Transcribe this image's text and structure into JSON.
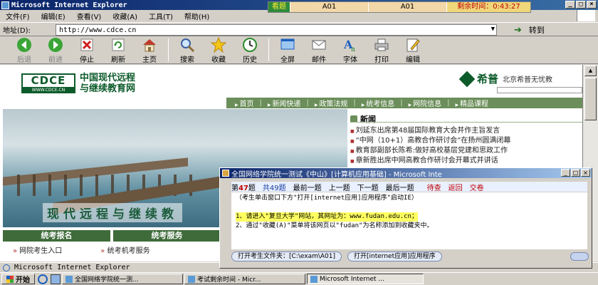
{
  "window": {
    "title": "Microsoft Internet Explorer"
  },
  "exam_strip": {
    "look_label": "看题",
    "field1": "A01",
    "field2": "A01",
    "timer_label": "剩余时间：0:43:27"
  },
  "menu": [
    "文件(F)",
    "编辑(E)",
    "查看(V)",
    "收藏(A)",
    "工具(T)",
    "帮助(H)"
  ],
  "address": {
    "label": "地址(D):",
    "url": "http://www.cdce.cn",
    "go_label": "转到"
  },
  "toolbar": {
    "back": "后退",
    "forward": "前进",
    "stop": "停止",
    "refresh": "刷新",
    "home": "主页",
    "search": "搜索",
    "favorites": "收藏",
    "history": "历史",
    "fullscreen": "全屏",
    "mail": "邮件",
    "font": "字体",
    "print": "打印",
    "edit": "编辑"
  },
  "page": {
    "logo_top": "CDCE",
    "logo_bottom": "WWW.CDCE.CN",
    "site_name_line1": "中国现代远程",
    "site_name_line2": "与继续教育网",
    "partner_name": "希普",
    "partner_desc": "北京希普无忧教",
    "nav": [
      "首页",
      "新闻快递",
      "政策法规",
      "统考信息",
      "网院信息",
      "精品课程"
    ],
    "hero_slogan": "现代远程与继续教",
    "news_title": "新闻",
    "news": [
      "刘延东出席第48届国际教育大会并作主旨发言",
      "“中网（10+1）高教合作研讨会”在扬州圆满闭幕",
      "教育部副部长陈希:做好高校基层党建和思政工作",
      "章新胜出席中网高教合作研讨会开幕式并讲话"
    ],
    "tabs": [
      "统考报名",
      "统考服务"
    ],
    "links": [
      "网院考生入口",
      "统考机考服务"
    ]
  },
  "dialog": {
    "title": "全国网络学院统一测试《中山》[计算机应用基础] - Microsoft Inte",
    "qno_prefix": "第",
    "qno_value": "47",
    "qno_suffix": "题",
    "total_prefix": "共",
    "total_value": "49",
    "total_suffix": "题",
    "first": "最前一题",
    "prev": "上一题",
    "next": "下一题",
    "last": "最后一题",
    "wait": "待查",
    "back": "返回",
    "submit": "交卷",
    "instruction": "（考生单击窗口下方\"打开[internet应用]应用程序\"启动IE）",
    "step1": "1、请进入\"复旦大学\"网站，其网址为：www.fudan.edu.cn；",
    "step2": "2、通过\"收藏(A)\"菜单将该网页以\"fudan\"为名称添加到收藏夹中。",
    "btn_open_folder": "打开考生文件夹：[C:\\exam\\A01]",
    "btn_open_app": "打开[internet应用]应用程序"
  },
  "statusbar": {
    "text": "Microsoft Internet Explorer"
  },
  "taskbar": {
    "start": "开始",
    "tasks": [
      "全国网络学院统一测...",
      "考试剩余时间 - Micr...",
      "Microsoft Internet ..."
    ]
  },
  "colors": {
    "titlebar": "#0a246a",
    "exam_green": "#2e8b3a",
    "timer_red": "#c00000",
    "site_green": "#0d5b2b"
  }
}
